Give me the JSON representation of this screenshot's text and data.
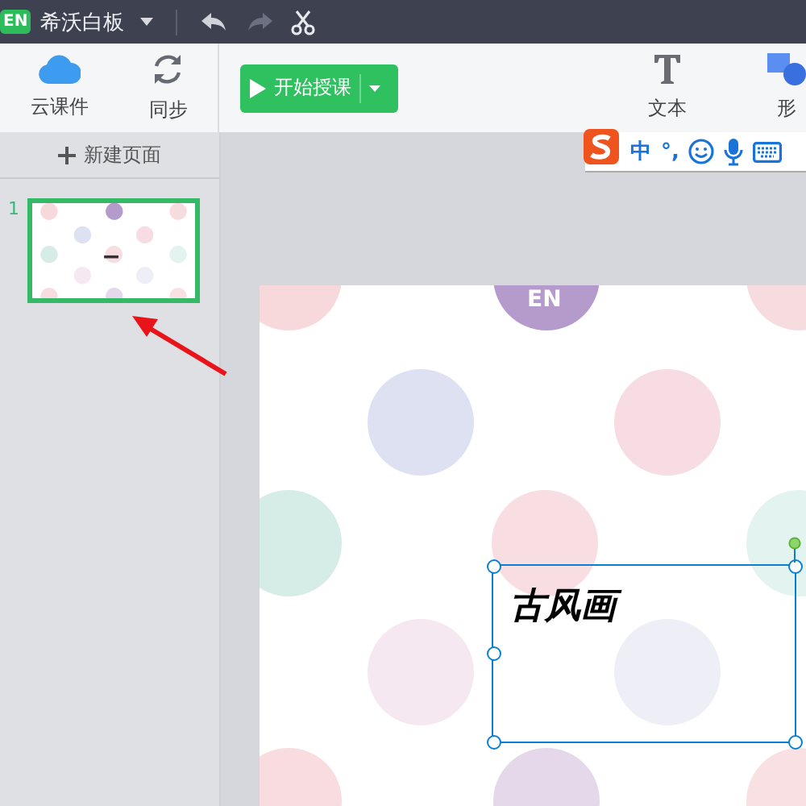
{
  "app": {
    "logo": "EN",
    "title": "希沃白板"
  },
  "toolbar": {
    "left": [
      {
        "kind": "cloud",
        "label": "云课件"
      },
      {
        "kind": "sync",
        "label": "同步"
      }
    ],
    "start_button": "开始授课",
    "tools": [
      {
        "kind": "text",
        "label": "文本"
      },
      {
        "kind": "shape",
        "label": "形"
      }
    ]
  },
  "pages": {
    "new_page": "新建页面",
    "items": [
      {
        "number": "1",
        "selected": true
      }
    ]
  },
  "ime": {
    "mode": "中",
    "punctuation": "°,"
  },
  "slide": {
    "badge": "EN",
    "textbox": {
      "text": "古风画",
      "selected": true
    }
  }
}
